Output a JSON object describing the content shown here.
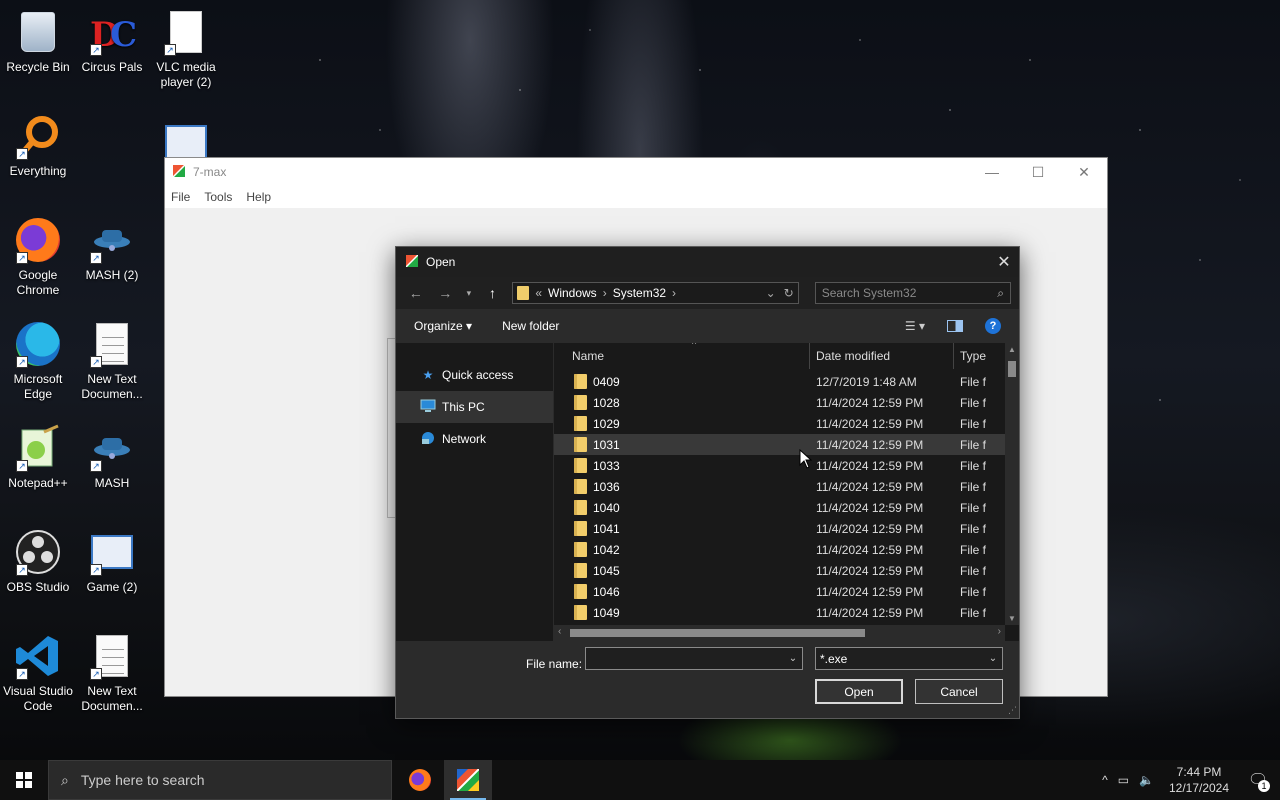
{
  "desktop": {
    "icons": [
      {
        "label": "Recycle Bin"
      },
      {
        "label": "Circus Pals"
      },
      {
        "label": "VLC media player (2)"
      },
      {
        "label": "Everything"
      },
      {
        "label": "Google Chrome"
      },
      {
        "label": "MASH (2)"
      },
      {
        "label": "Microsoft Edge"
      },
      {
        "label": "New Text Documen..."
      },
      {
        "label": "Notepad++"
      },
      {
        "label": "MASH"
      },
      {
        "label": "OBS Studio"
      },
      {
        "label": "Game (2)"
      },
      {
        "label": "Visual Studio Code"
      },
      {
        "label": "New Text Documen..."
      }
    ]
  },
  "app_window": {
    "title": "7-max",
    "menu": [
      "File",
      "Tools",
      "Help"
    ],
    "minimize": "—",
    "maximize": "☐",
    "close": "✕"
  },
  "dialog": {
    "title": "Open",
    "close": "✕",
    "breadcrumb": {
      "prefix": "«",
      "items": [
        "Windows",
        "System32"
      ]
    },
    "search_placeholder": "Search System32",
    "toolbar": {
      "organize": "Organize ▾",
      "new_folder": "New folder",
      "help": "?"
    },
    "nav_pane": [
      {
        "label": "Quick access",
        "icon": "star-icon"
      },
      {
        "label": "This PC",
        "icon": "computer-icon",
        "selected": true
      },
      {
        "label": "Network",
        "icon": "network-icon"
      }
    ],
    "columns": {
      "name": "Name",
      "date": "Date modified",
      "type": "Type"
    },
    "files": [
      {
        "name": "0409",
        "date": "12/7/2019 1:48 AM",
        "type": "File f"
      },
      {
        "name": "1028",
        "date": "11/4/2024 12:59 PM",
        "type": "File f"
      },
      {
        "name": "1029",
        "date": "11/4/2024 12:59 PM",
        "type": "File f"
      },
      {
        "name": "1031",
        "date": "11/4/2024 12:59 PM",
        "type": "File f",
        "hover": true
      },
      {
        "name": "1033",
        "date": "11/4/2024 12:59 PM",
        "type": "File f"
      },
      {
        "name": "1036",
        "date": "11/4/2024 12:59 PM",
        "type": "File f"
      },
      {
        "name": "1040",
        "date": "11/4/2024 12:59 PM",
        "type": "File f"
      },
      {
        "name": "1041",
        "date": "11/4/2024 12:59 PM",
        "type": "File f"
      },
      {
        "name": "1042",
        "date": "11/4/2024 12:59 PM",
        "type": "File f"
      },
      {
        "name": "1045",
        "date": "11/4/2024 12:59 PM",
        "type": "File f"
      },
      {
        "name": "1046",
        "date": "11/4/2024 12:59 PM",
        "type": "File f"
      },
      {
        "name": "1049",
        "date": "11/4/2024 12:59 PM",
        "type": "File f"
      }
    ],
    "file_name_label": "File name:",
    "file_name_value": "",
    "filter": "*.exe",
    "open_button": "Open",
    "cancel_button": "Cancel"
  },
  "taskbar": {
    "search_placeholder": "Type here to search",
    "time": "7:44 PM",
    "date": "12/17/2024",
    "notification_count": "1"
  },
  "colors": {
    "dialog_bg": "#2b2b2b",
    "pane_bg": "#191919",
    "folder": "#f2cd6a",
    "accent": "#1e73d8",
    "taskbar": "#101010"
  }
}
